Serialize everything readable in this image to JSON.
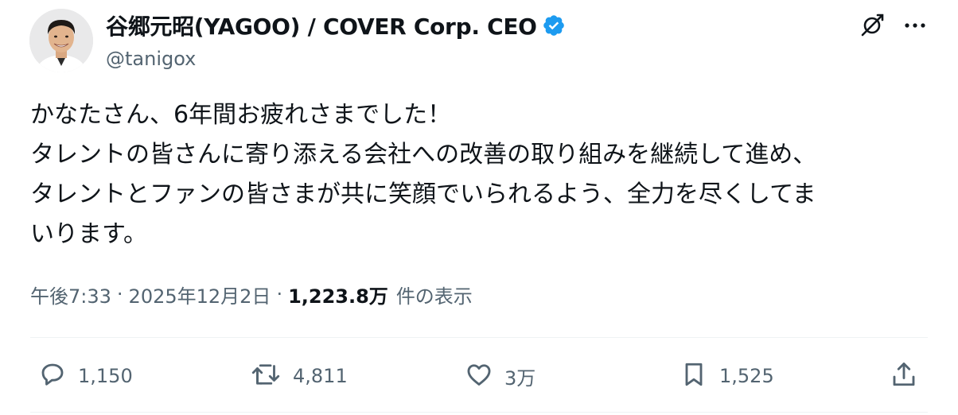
{
  "author": {
    "display_name": "谷郷元昭(YAGOO) / COVER Corp. CEO",
    "handle": "@tanigox",
    "verified": true,
    "avatar_icon": "user-avatar-photo"
  },
  "top_actions": {
    "grok_icon": "grok-slash-icon",
    "more_icon": "more-dots-icon"
  },
  "tweet": {
    "text": "かなたさん、6年間お疲れさまでした！\nタレントの皆さんに寄り添える会社への改善の取り組みを継続して進め、\nタレントとファンの皆さまが共に笑顔でいられるよう、全力を尽くしてま\nいります。",
    "time": "午後7:33",
    "date": "2025年12月2日",
    "separator": "·",
    "views_count": "1,223.8万",
    "views_label": "件の表示"
  },
  "actions": {
    "reply": {
      "icon": "reply-icon",
      "count": "1,150"
    },
    "retweet": {
      "icon": "retweet-icon",
      "count": "4,811"
    },
    "like": {
      "icon": "heart-icon",
      "count": "3万"
    },
    "bookmark": {
      "icon": "bookmark-icon",
      "count": "1,525"
    },
    "share": {
      "icon": "share-icon"
    }
  },
  "colors": {
    "text": "#0f1419",
    "secondary": "#536471",
    "verified": "#1d9bf0",
    "divider": "#eff3f4"
  }
}
